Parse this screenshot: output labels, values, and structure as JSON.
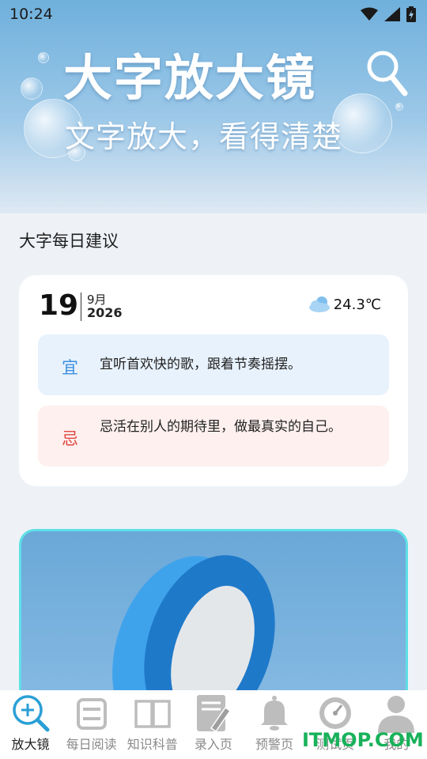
{
  "status_bar": {
    "time": "10:24"
  },
  "hero": {
    "title": "大字放大镜",
    "subtitle": "文字放大，看得清楚",
    "id_text": "ID:001f5"
  },
  "section": {
    "title": "大字每日建议"
  },
  "advice_card": {
    "day": "19",
    "month": "9月",
    "year": "2026",
    "temperature": "24.3℃",
    "weather_icon": "cloudy-icon",
    "yi": {
      "label": "宜",
      "text": "宜听首欢快的歌，跟着节奏摇摆。",
      "color": "#3a8fe0"
    },
    "ji": {
      "label": "忌",
      "text": "忌活在别人的期待里，做最真实的自己。",
      "color": "#e0473e"
    }
  },
  "nav": {
    "items": [
      {
        "label": "放大镜",
        "icon": "magnifier-icon",
        "active": true
      },
      {
        "label": "每日阅读",
        "icon": "scroll-icon",
        "active": false
      },
      {
        "label": "知识科普",
        "icon": "book-icon",
        "active": false
      },
      {
        "label": "录入页",
        "icon": "notepad-icon",
        "active": false
      },
      {
        "label": "预警页",
        "icon": "bell-icon",
        "active": false
      },
      {
        "label": "测试页",
        "icon": "gauge-icon",
        "active": false
      },
      {
        "label": "我的",
        "icon": "person-icon",
        "active": false
      }
    ]
  },
  "watermark": "ITMOP.COM",
  "colors": {
    "accent": "#2a9fd6",
    "inactive": "#a9a9a9"
  }
}
